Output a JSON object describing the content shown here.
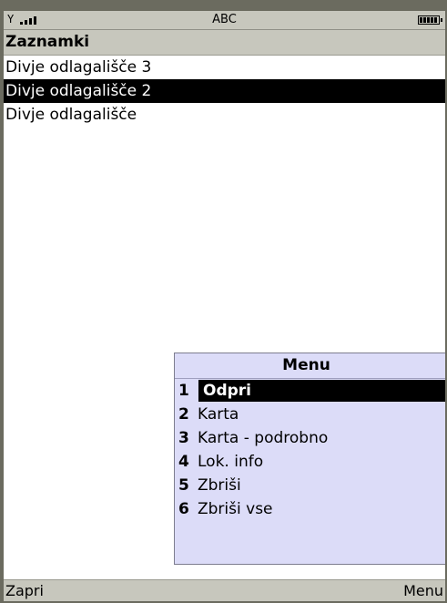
{
  "status": {
    "signal_icon": "antenna-icon",
    "input_mode": "ABC",
    "battery_icon": "battery-icon"
  },
  "title": "Zaznamki",
  "list": {
    "items": [
      {
        "label": "Divje odlagališče 3",
        "selected": false
      },
      {
        "label": "Divje odlagališče 2",
        "selected": true
      },
      {
        "label": "Divje odlagališče",
        "selected": false
      }
    ]
  },
  "menu": {
    "title": "Menu",
    "items": [
      {
        "num": "1",
        "label": "Odpri",
        "selected": true
      },
      {
        "num": "2",
        "label": "Karta",
        "selected": false
      },
      {
        "num": "3",
        "label": "Karta - podrobno",
        "selected": false
      },
      {
        "num": "4",
        "label": "Lok. info",
        "selected": false
      },
      {
        "num": "5",
        "label": "Zbriši",
        "selected": false
      },
      {
        "num": "6",
        "label": "Zbriši vse",
        "selected": false
      }
    ]
  },
  "softkeys": {
    "left": "Zapri",
    "right": "Menu"
  }
}
